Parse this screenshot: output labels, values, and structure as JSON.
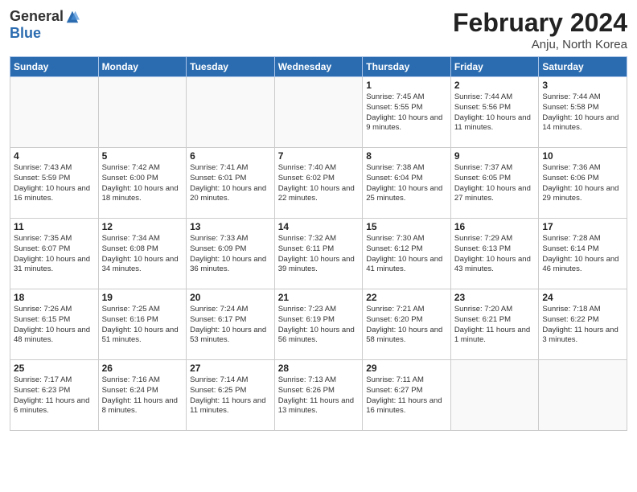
{
  "logo": {
    "general": "General",
    "blue": "Blue"
  },
  "header": {
    "title": "February 2024",
    "location": "Anju, North Korea"
  },
  "weekdays": [
    "Sunday",
    "Monday",
    "Tuesday",
    "Wednesday",
    "Thursday",
    "Friday",
    "Saturday"
  ],
  "weeks": [
    [
      {
        "day": "",
        "info": ""
      },
      {
        "day": "",
        "info": ""
      },
      {
        "day": "",
        "info": ""
      },
      {
        "day": "",
        "info": ""
      },
      {
        "day": "1",
        "info": "Sunrise: 7:45 AM\nSunset: 5:55 PM\nDaylight: 10 hours and 9 minutes."
      },
      {
        "day": "2",
        "info": "Sunrise: 7:44 AM\nSunset: 5:56 PM\nDaylight: 10 hours and 11 minutes."
      },
      {
        "day": "3",
        "info": "Sunrise: 7:44 AM\nSunset: 5:58 PM\nDaylight: 10 hours and 14 minutes."
      }
    ],
    [
      {
        "day": "4",
        "info": "Sunrise: 7:43 AM\nSunset: 5:59 PM\nDaylight: 10 hours and 16 minutes."
      },
      {
        "day": "5",
        "info": "Sunrise: 7:42 AM\nSunset: 6:00 PM\nDaylight: 10 hours and 18 minutes."
      },
      {
        "day": "6",
        "info": "Sunrise: 7:41 AM\nSunset: 6:01 PM\nDaylight: 10 hours and 20 minutes."
      },
      {
        "day": "7",
        "info": "Sunrise: 7:40 AM\nSunset: 6:02 PM\nDaylight: 10 hours and 22 minutes."
      },
      {
        "day": "8",
        "info": "Sunrise: 7:38 AM\nSunset: 6:04 PM\nDaylight: 10 hours and 25 minutes."
      },
      {
        "day": "9",
        "info": "Sunrise: 7:37 AM\nSunset: 6:05 PM\nDaylight: 10 hours and 27 minutes."
      },
      {
        "day": "10",
        "info": "Sunrise: 7:36 AM\nSunset: 6:06 PM\nDaylight: 10 hours and 29 minutes."
      }
    ],
    [
      {
        "day": "11",
        "info": "Sunrise: 7:35 AM\nSunset: 6:07 PM\nDaylight: 10 hours and 31 minutes."
      },
      {
        "day": "12",
        "info": "Sunrise: 7:34 AM\nSunset: 6:08 PM\nDaylight: 10 hours and 34 minutes."
      },
      {
        "day": "13",
        "info": "Sunrise: 7:33 AM\nSunset: 6:09 PM\nDaylight: 10 hours and 36 minutes."
      },
      {
        "day": "14",
        "info": "Sunrise: 7:32 AM\nSunset: 6:11 PM\nDaylight: 10 hours and 39 minutes."
      },
      {
        "day": "15",
        "info": "Sunrise: 7:30 AM\nSunset: 6:12 PM\nDaylight: 10 hours and 41 minutes."
      },
      {
        "day": "16",
        "info": "Sunrise: 7:29 AM\nSunset: 6:13 PM\nDaylight: 10 hours and 43 minutes."
      },
      {
        "day": "17",
        "info": "Sunrise: 7:28 AM\nSunset: 6:14 PM\nDaylight: 10 hours and 46 minutes."
      }
    ],
    [
      {
        "day": "18",
        "info": "Sunrise: 7:26 AM\nSunset: 6:15 PM\nDaylight: 10 hours and 48 minutes."
      },
      {
        "day": "19",
        "info": "Sunrise: 7:25 AM\nSunset: 6:16 PM\nDaylight: 10 hours and 51 minutes."
      },
      {
        "day": "20",
        "info": "Sunrise: 7:24 AM\nSunset: 6:17 PM\nDaylight: 10 hours and 53 minutes."
      },
      {
        "day": "21",
        "info": "Sunrise: 7:23 AM\nSunset: 6:19 PM\nDaylight: 10 hours and 56 minutes."
      },
      {
        "day": "22",
        "info": "Sunrise: 7:21 AM\nSunset: 6:20 PM\nDaylight: 10 hours and 58 minutes."
      },
      {
        "day": "23",
        "info": "Sunrise: 7:20 AM\nSunset: 6:21 PM\nDaylight: 11 hours and 1 minute."
      },
      {
        "day": "24",
        "info": "Sunrise: 7:18 AM\nSunset: 6:22 PM\nDaylight: 11 hours and 3 minutes."
      }
    ],
    [
      {
        "day": "25",
        "info": "Sunrise: 7:17 AM\nSunset: 6:23 PM\nDaylight: 11 hours and 6 minutes."
      },
      {
        "day": "26",
        "info": "Sunrise: 7:16 AM\nSunset: 6:24 PM\nDaylight: 11 hours and 8 minutes."
      },
      {
        "day": "27",
        "info": "Sunrise: 7:14 AM\nSunset: 6:25 PM\nDaylight: 11 hours and 11 minutes."
      },
      {
        "day": "28",
        "info": "Sunrise: 7:13 AM\nSunset: 6:26 PM\nDaylight: 11 hours and 13 minutes."
      },
      {
        "day": "29",
        "info": "Sunrise: 7:11 AM\nSunset: 6:27 PM\nDaylight: 11 hours and 16 minutes."
      },
      {
        "day": "",
        "info": ""
      },
      {
        "day": "",
        "info": ""
      }
    ]
  ]
}
